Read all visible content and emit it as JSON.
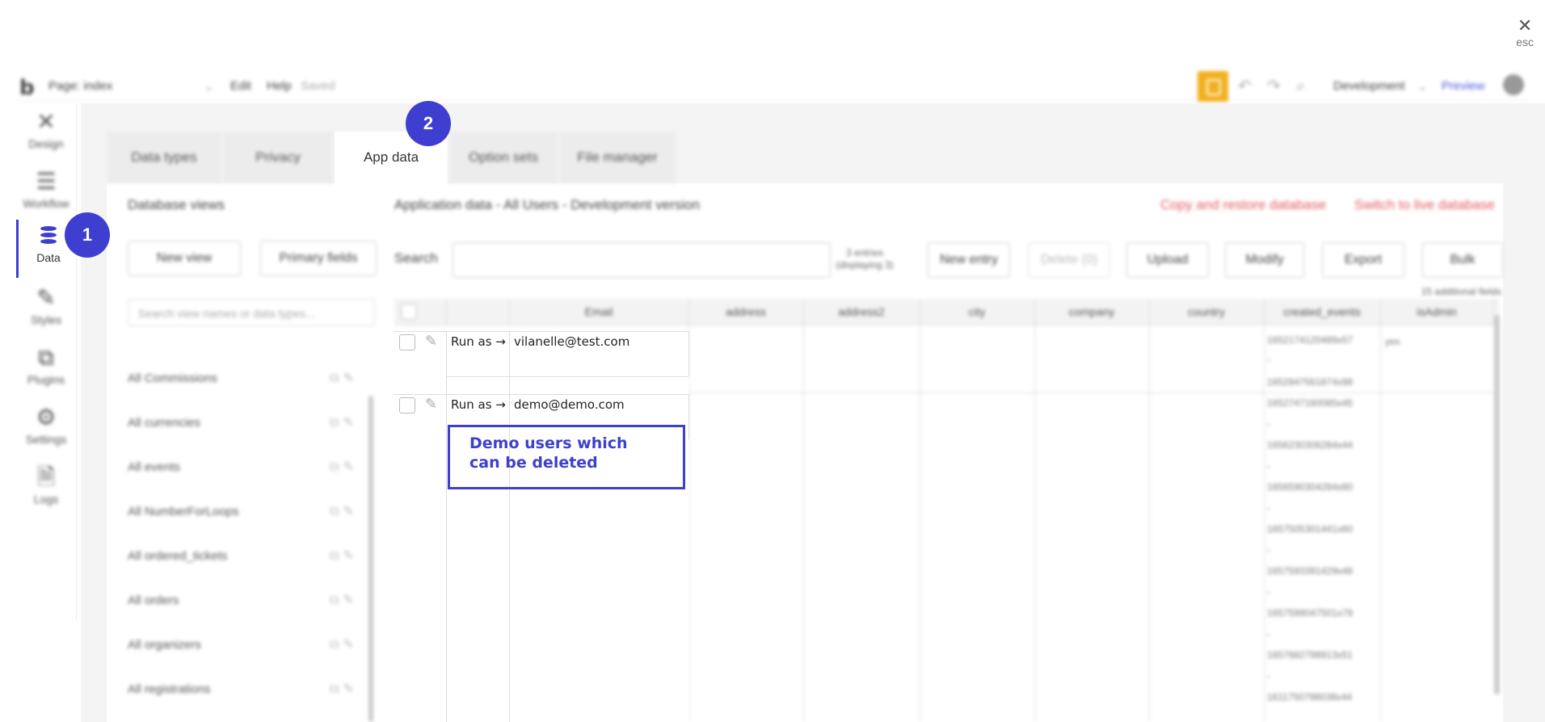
{
  "close": {
    "icon": "close-icon",
    "label": "esc"
  },
  "topbar": {
    "page_label": "Page: index",
    "menu": [
      "Edit",
      "Help"
    ],
    "saved": "Saved",
    "environment": "Development",
    "preview": "Preview"
  },
  "nav": {
    "items": [
      {
        "label": "Design",
        "icon": "design-icon"
      },
      {
        "label": "Workflow",
        "icon": "workflow-icon"
      },
      {
        "label": "Data",
        "icon": "database-icon",
        "active": true
      },
      {
        "label": "Styles",
        "icon": "brush-icon"
      },
      {
        "label": "Plugins",
        "icon": "plugin-icon"
      },
      {
        "label": "Settings",
        "icon": "gear-icon"
      },
      {
        "label": "Logs",
        "icon": "document-icon"
      }
    ]
  },
  "badges": {
    "one": "1",
    "two": "2"
  },
  "tabs": [
    "Data types",
    "Privacy",
    "App data",
    "Option sets",
    "File manager"
  ],
  "views": {
    "title": "Database views",
    "new_view": "New view",
    "primary_fields": "Primary fields",
    "search_placeholder": "Search view names or data types...",
    "items": [
      "All Commissions",
      "All currencies",
      "All events",
      "All NumberForLoops",
      "All ordered_tickets",
      "All orders",
      "All organizers",
      "All registrations"
    ]
  },
  "appdata": {
    "title": "Application data - All Users - Development version",
    "copy_restore": "Copy and restore database",
    "switch_live": "Switch to live database",
    "search_label": "Search",
    "entries_line1": "3 entries",
    "entries_line2": "(displaying 3)",
    "new_entry": "New entry",
    "delete": "Delete (0)",
    "upload": "Upload",
    "modify": "Modify",
    "export": "Export",
    "bulk": "Bulk",
    "additional_fields": "15 additional fields"
  },
  "table": {
    "columns": [
      "Email",
      "address",
      "address2",
      "city",
      "company",
      "country",
      "created_events",
      "isAdmin"
    ],
    "rows": [
      {
        "run_as": "Run as →",
        "email": "vilanelle@test.com",
        "isAdmin": "yes",
        "created": [
          "1652174120489x57",
          "-",
          "1652847561874x98"
        ]
      },
      {
        "run_as": "Run as →",
        "email": "demo@demo.com",
        "created": [
          "1652747160085x45",
          "-",
          "1656230306284x44",
          "-",
          "1656590304284x80",
          "-",
          "1657505301441x60",
          "-",
          "1657593391429x48",
          "-",
          "1657599047501x79",
          "-",
          "1657682798913x51",
          "-",
          "1611750798038x44"
        ]
      }
    ]
  },
  "annotation": {
    "line1": "Demo users which",
    "line2": "can be deleted"
  }
}
